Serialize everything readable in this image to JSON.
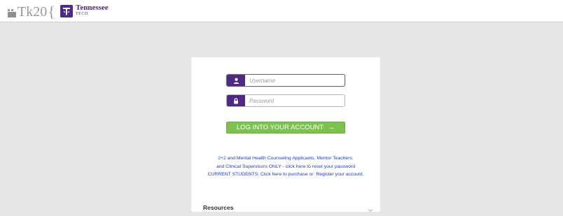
{
  "header": {
    "tk20_logo_text": "Tk20",
    "tk20_brace": "{",
    "university_name": "Tennessee",
    "university_sub": "TECH"
  },
  "login": {
    "username_placeholder": "Username",
    "password_placeholder": "Password",
    "submit_label": "LOG INTO YOUR ACCOUNT",
    "submit_arrow": "→"
  },
  "info": {
    "line1": "2+2 and Mental Health Counseling Applicants, Mentor Teachers,",
    "line2": "and Clinical Supervisors ONLY - click here to reset your password",
    "line3_prefix": "CURRENT STUDENTS: Click here to purchase or",
    "line3_link": "Register your account."
  },
  "resources": {
    "title": "Resources"
  },
  "colors": {
    "brand_purple": "#4f2984",
    "button_green": "#7cc24f",
    "link_blue": "#1a3bd6"
  },
  "icons": {
    "username_addon": "user-icon",
    "password_addon": "lock-icon",
    "resources_toggle": "chevron-down-icon"
  }
}
